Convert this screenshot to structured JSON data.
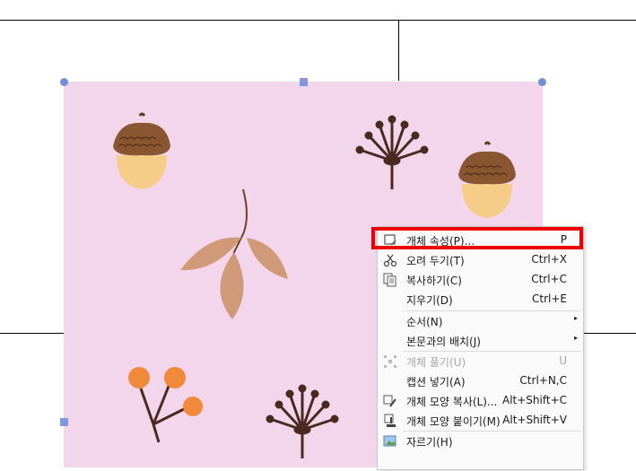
{
  "context_menu": {
    "items": [
      {
        "label": "개체 속성(P)...",
        "shortcut": "P",
        "icon": "object-properties-icon",
        "disabled": false
      },
      {
        "label": "오려 두기(T)",
        "shortcut": "Ctrl+X",
        "icon": "scissors-icon",
        "disabled": false
      },
      {
        "label": "복사하기(C)",
        "shortcut": "Ctrl+C",
        "icon": "copy-icon",
        "disabled": false
      },
      {
        "label": "지우기(D)",
        "shortcut": "Ctrl+E",
        "icon": "",
        "disabled": false
      },
      {
        "label": "순서(N)",
        "shortcut": "",
        "icon": "",
        "disabled": false,
        "submenu": true
      },
      {
        "label": "본문과의 배치(J)",
        "shortcut": "",
        "icon": "",
        "disabled": false,
        "submenu": true
      },
      {
        "label": "개체 풀기(U)",
        "shortcut": "U",
        "icon": "ungroup-icon",
        "disabled": true
      },
      {
        "label": "캡션 넣기(A)",
        "shortcut": "Ctrl+N,C",
        "icon": "",
        "disabled": false
      },
      {
        "label": "개체 모양 복사(L)...",
        "shortcut": "Alt+Shift+C",
        "icon": "copy-format-icon",
        "disabled": false
      },
      {
        "label": "개체 모양 붙이기(M)",
        "shortcut": "Alt+Shift+V",
        "icon": "paste-format-icon",
        "disabled": false
      },
      {
        "label": "자르기(H)",
        "shortcut": "",
        "icon": "crop-icon",
        "disabled": false
      }
    ],
    "submenu_arrow": "▸"
  },
  "colors": {
    "highlight": "#ee0000",
    "image_bg": "#f3d5ec",
    "handle": "#6f8fd8"
  }
}
